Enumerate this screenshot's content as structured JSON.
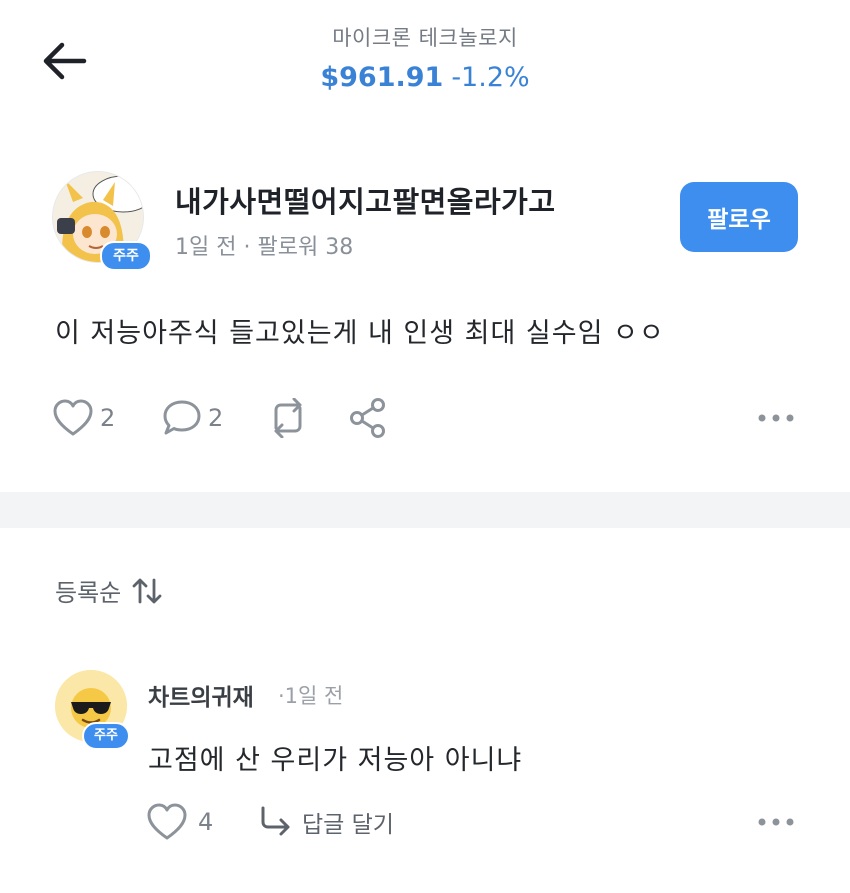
{
  "header": {
    "stock_name": "마이크론 테크놀로지",
    "price": "$961.91",
    "change": "-1.2%",
    "accent_color": "#3a82d6"
  },
  "post": {
    "author": "내가사면떨어지고팔면올라가고",
    "badge": "주주",
    "time": "1일 전",
    "separator": "·",
    "followers_label": "팔로워 38",
    "follow_label": "팔로우",
    "body": "이 저능아주식 들고있는게 내 인생 최대 실수임 ㅇㅇ",
    "likes": "2",
    "comments": "2",
    "icons": [
      "heart-icon",
      "comment-icon",
      "repost-icon",
      "share-icon",
      "more-icon"
    ]
  },
  "sort": {
    "label": "등록순",
    "icon": "sort-icon"
  },
  "comment": {
    "author": "차트의귀재",
    "badge": "주주",
    "time": "·1일 전",
    "body": "고점에 산 우리가 저능아 아니냐",
    "likes": "4",
    "reply_label": "답글 달기",
    "icons": [
      "heart-icon",
      "reply-arrow-icon",
      "more-icon"
    ]
  },
  "colors": {
    "button": "#3e8ef0",
    "divider": "#f2f4f6",
    "icon": "#8d939b"
  }
}
